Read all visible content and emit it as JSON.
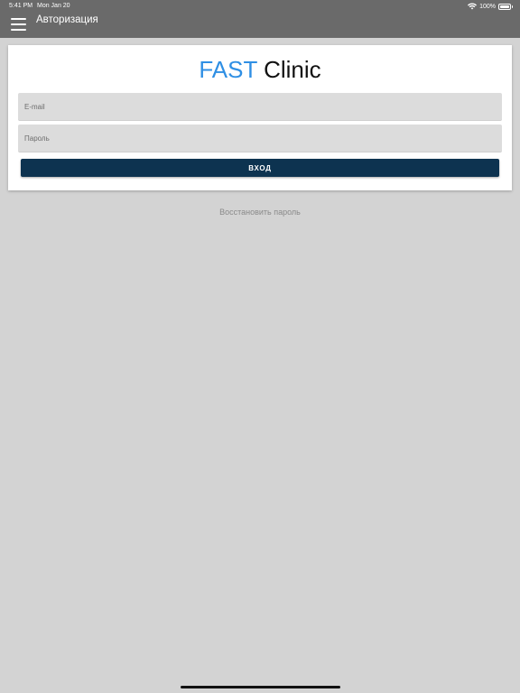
{
  "status_bar": {
    "time": "5:41 PM",
    "date": "Mon Jan 20",
    "battery": "100%",
    "wifi_icon": "wifi-icon",
    "battery_icon": "battery-icon"
  },
  "nav": {
    "title": "Авторизация",
    "menu_icon": "hamburger-menu-icon",
    "bar_color": "#6a6a6a"
  },
  "logo": {
    "part1": "FAST",
    "part2": "Clinic",
    "part1_color": "#2f8fe4",
    "part2_color": "#111111"
  },
  "form": {
    "email": {
      "value": "",
      "placeholder": "E-mail"
    },
    "password": {
      "value": "",
      "placeholder": "Пароль"
    },
    "login_label": "Вход",
    "login_color": "#0d3350"
  },
  "restore_link": "Восстановить пароль",
  "colors": {
    "background": "#d3d3d3",
    "card": "#ffffff"
  }
}
